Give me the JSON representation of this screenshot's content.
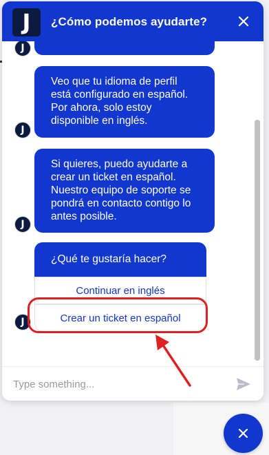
{
  "header": {
    "logo_letter": "J",
    "title": "¿Cómo podemos ayudarte?",
    "close_icon": "close-icon"
  },
  "messages": [
    {
      "id": "msg-language",
      "lines": [
        "Veo que tu idioma de perfil",
        "está configurado en español.",
        "Por ahora, solo estoy",
        "disponible en inglés."
      ]
    },
    {
      "id": "msg-ticket-offer",
      "lines": [
        "Si quieres, puedo ayudarte a",
        "crear un ticket en español.",
        "Nuestro equipo de soporte se",
        "pondrá en contacto contigo lo",
        "antes posible."
      ]
    }
  ],
  "avatar_letter": "J",
  "choice": {
    "prompt": "¿Qué te gustaría hacer?",
    "options": [
      "Continuar en inglés",
      "Crear un ticket en español"
    ],
    "highlighted_option": "Crear un ticket en español"
  },
  "composer": {
    "placeholder": "Type something...",
    "value": "",
    "send_icon": "send-icon"
  },
  "launcher": {
    "icon": "close-icon"
  },
  "colors": {
    "brand": "#1237cf",
    "logo_bg": "#0b1a3e",
    "annotation": "#e02020"
  }
}
